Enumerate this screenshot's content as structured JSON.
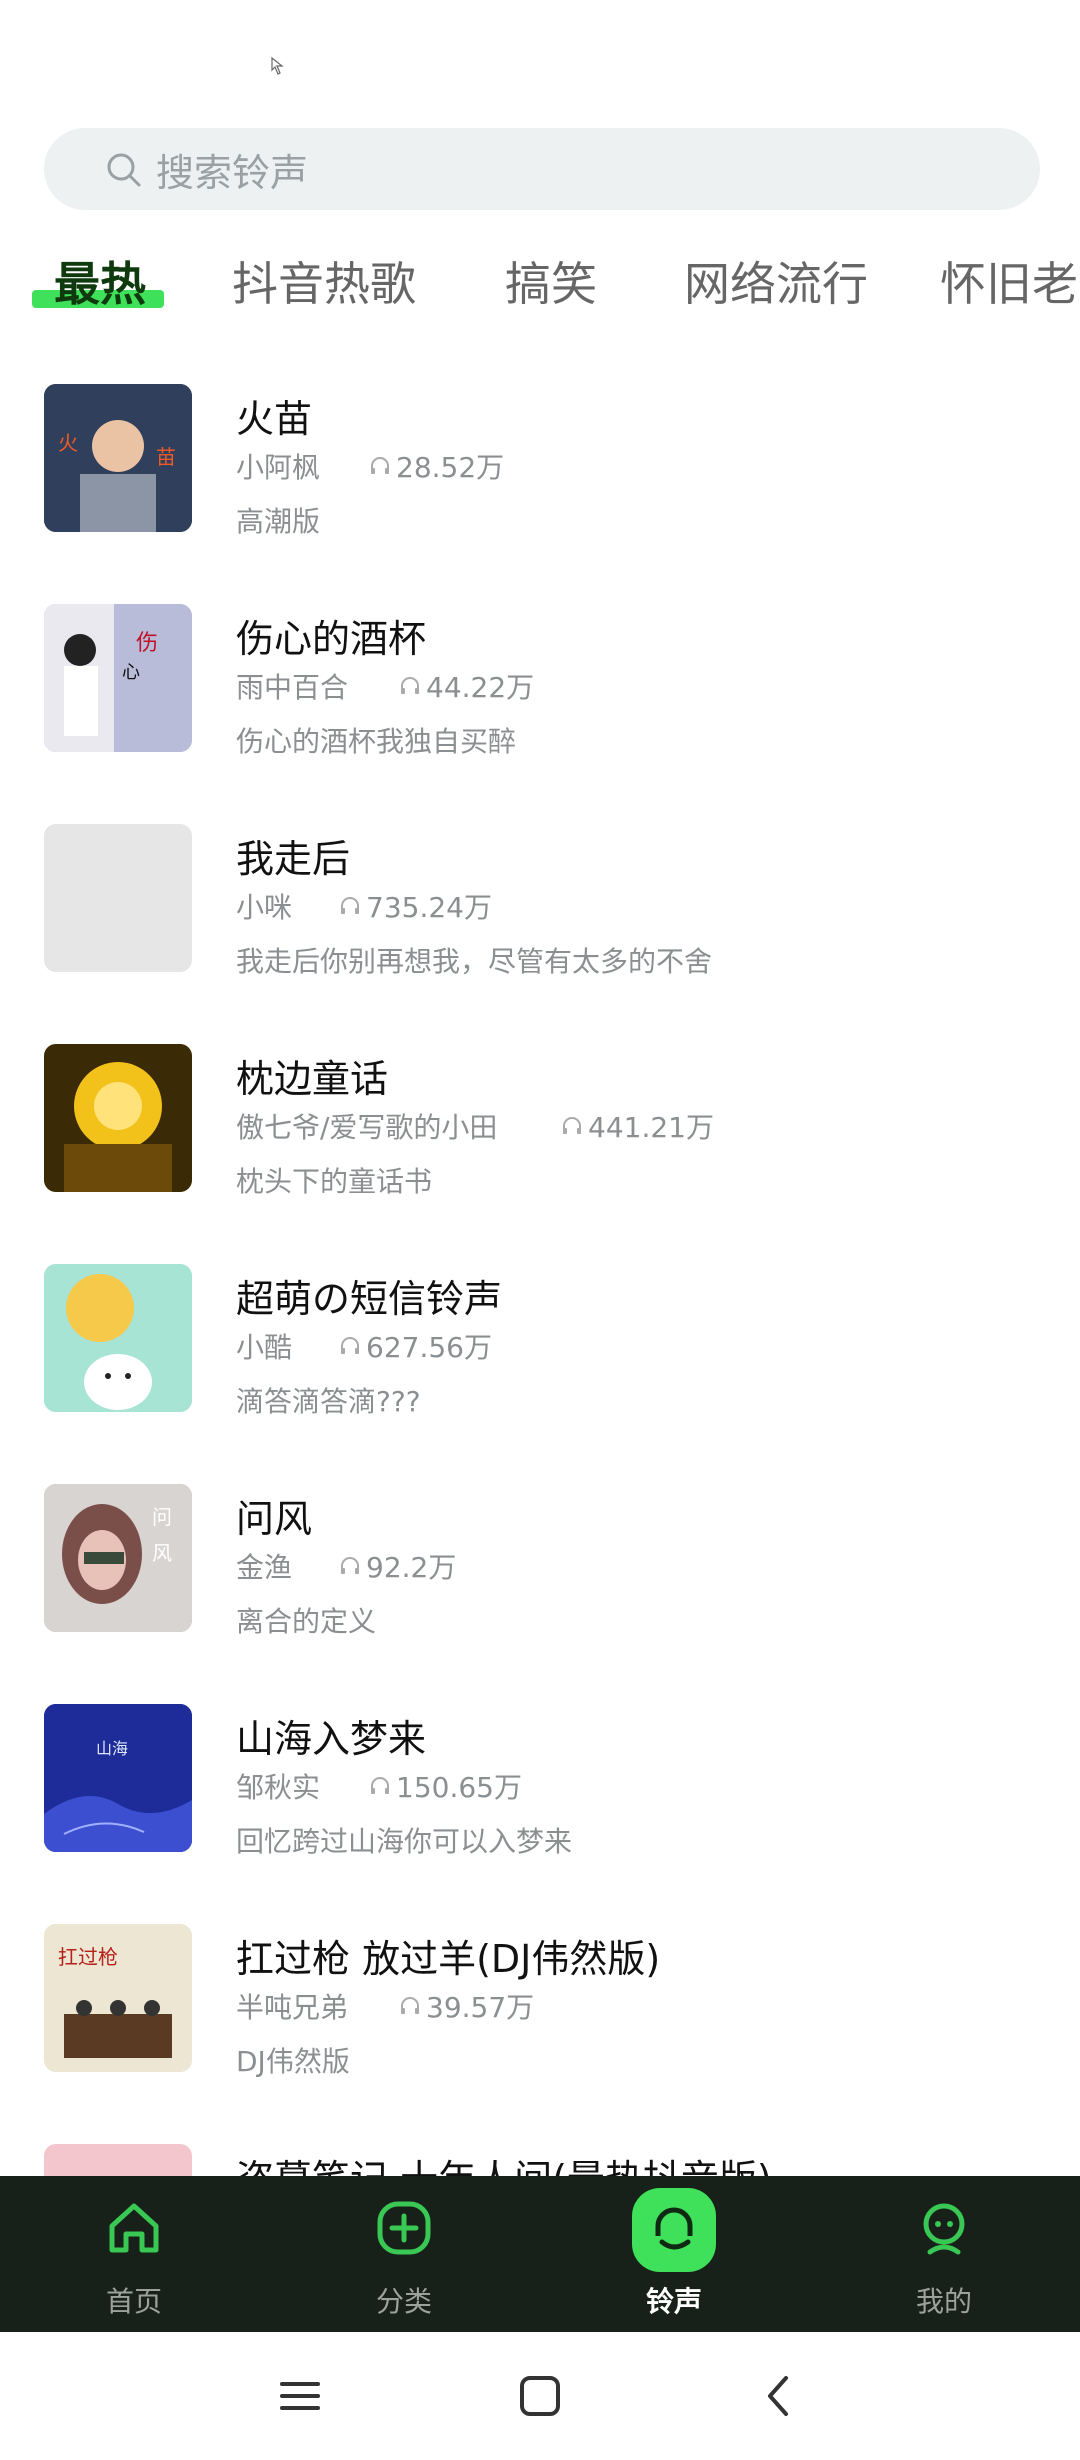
{
  "search": {
    "placeholder": "搜索铃声"
  },
  "tabs": [
    {
      "label": "最热",
      "active": true
    },
    {
      "label": "抖音热歌"
    },
    {
      "label": "搞笑"
    },
    {
      "label": "网络流行"
    },
    {
      "label": "怀旧老"
    }
  ],
  "list": [
    {
      "title": "火苗",
      "artist": "小阿枫",
      "plays": "28.52万",
      "desc": "高潮版",
      "cover_color": "#3a4b66"
    },
    {
      "title": "伤心的酒杯",
      "artist": "雨中百合",
      "plays": "44.22万",
      "desc": "伤心的酒杯我独自买醉",
      "cover_color": "#c9cbe0"
    },
    {
      "title": "我走后",
      "artist": "小咪",
      "plays": "735.24万",
      "desc": "我走后你别再想我，尽管有太多的不舍",
      "cover_color": "#e6e6e6"
    },
    {
      "title": "枕边童话",
      "artist": "傲七爷/爱写歌的小田",
      "plays": "441.21万",
      "desc": "枕头下的童话书",
      "cover_color": "#d99b10"
    },
    {
      "title": "超萌の短信铃声",
      "artist": "小酷",
      "plays": "627.56万",
      "desc": "滴答滴答滴???",
      "cover_color": "#9fe0cf"
    },
    {
      "title": "问风",
      "artist": "金渔",
      "plays": "92.2万",
      "desc": "离合的定义",
      "cover_color": "#b79a94"
    },
    {
      "title": "山海入梦来",
      "artist": "邹秋实",
      "plays": "150.65万",
      "desc": "回忆跨过山海你可以入梦来",
      "cover_color": "#2434a8"
    },
    {
      "title": "扛过枪 放过羊(DJ伟然版)",
      "artist": "半吨兄弟",
      "plays": "39.57万",
      "desc": "DJ伟然版",
      "cover_color": "#e9e3cf"
    },
    {
      "title": "盗墓笔记·十年人间(最热抖音版)",
      "artist": "",
      "plays": "",
      "desc": "",
      "cover_color": "#f2c6cc"
    }
  ],
  "nav": [
    {
      "label": "首页",
      "icon": "home-icon"
    },
    {
      "label": "分类",
      "icon": "add-square-icon"
    },
    {
      "label": "铃声",
      "icon": "ringtone-bubble-icon",
      "active": true
    },
    {
      "label": "我的",
      "icon": "profile-icon"
    }
  ],
  "colors": {
    "accent": "#3fe05a",
    "nav_bg": "#17211a",
    "text_secondary": "#8b8f91"
  }
}
